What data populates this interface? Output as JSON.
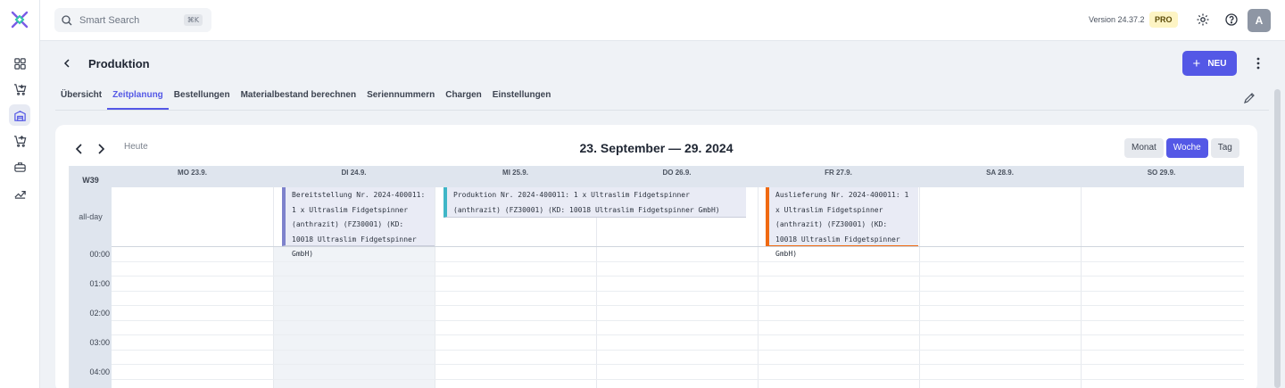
{
  "search": {
    "placeholder": "Smart Search",
    "shortcut": "⌘K"
  },
  "topbar": {
    "version": "Version 24.37.2",
    "badge": "PRO",
    "avatar": "A",
    "icons": [
      "settings-icon",
      "help-icon"
    ]
  },
  "sidebar": {
    "items": [
      "dashboard-icon",
      "purchase-cart-icon",
      "warehouse-icon",
      "sales-cart-icon",
      "production-icon",
      "analytics-icon"
    ],
    "active": "warehouse-icon"
  },
  "header": {
    "title": "Produktion",
    "new_button": "NEU"
  },
  "tabs": [
    {
      "label": "Übersicht",
      "active": false
    },
    {
      "label": "Zeitplanung",
      "active": true
    },
    {
      "label": "Bestellungen",
      "active": false
    },
    {
      "label": "Materialbestand berechnen",
      "active": false
    },
    {
      "label": "Seriennummern",
      "active": false
    },
    {
      "label": "Chargen",
      "active": false
    },
    {
      "label": "Einstellungen",
      "active": false
    }
  ],
  "calendar": {
    "today_label": "Heute",
    "title": "23. September — 29. 2024",
    "views": [
      {
        "label": "Monat",
        "active": false
      },
      {
        "label": "Woche",
        "active": true
      },
      {
        "label": "Tag",
        "active": false
      }
    ],
    "week": "W39",
    "allday_label": "all-day",
    "days": [
      "MO 23.9.",
      "DI 24.9.",
      "MI 25.9.",
      "DO 26.9.",
      "FR 27.9.",
      "SA 28.9.",
      "SO 29.9."
    ],
    "times": [
      "00:00",
      "01:00",
      "02:00",
      "03:00",
      "04:00"
    ],
    "events": [
      {
        "text": "Bereitstellung Nr. 2024-400011: 1 x Ultraslim Fidgetspinner (anthrazit) (FZ30001) (KD: 10018 Ultraslim Fidgetspinner GmbH)",
        "color": "#7e82cc"
      },
      {
        "text": "Produktion Nr. 2024-400011: 1 x Ultraslim Fidgetspinner (anthrazit) (FZ30001) (KD: 10018 Ultraslim Fidgetspinner GmbH)",
        "color": "#3fb6c7"
      },
      {
        "text": "Auslieferung Nr. 2024-400011: 1 x Ultraslim Fidgetspinner (anthrazit) (FZ30001) (KD: 10018 Ultraslim Fidgetspinner GmbH)",
        "color": "#f06a12"
      }
    ]
  },
  "colors": {
    "accent": "#5458e6",
    "pro_badge": "#fdf4c4"
  }
}
